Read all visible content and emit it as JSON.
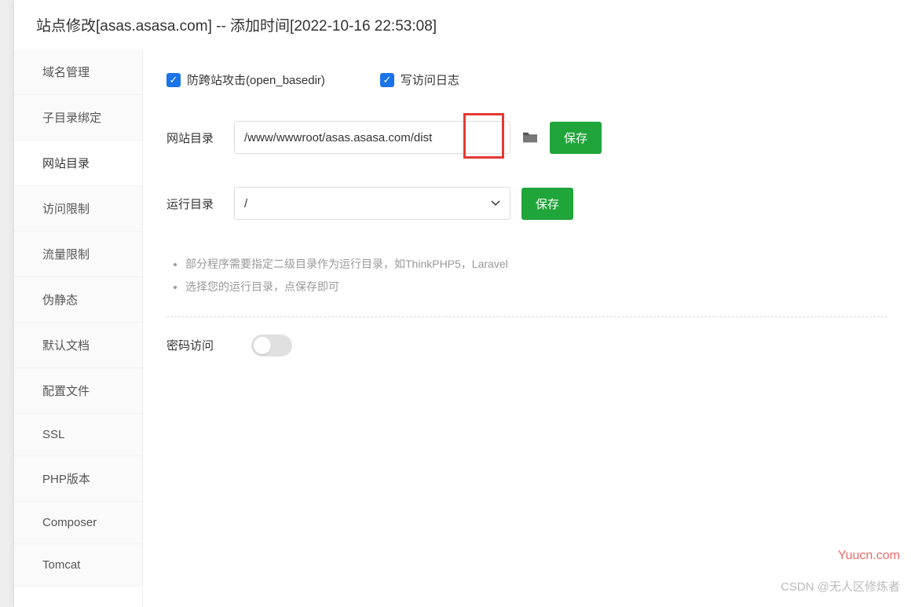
{
  "header": {
    "title": "站点修改[asas.asasa.com] -- 添加时间[2022-10-16 22:53:08]"
  },
  "sidebar": {
    "items": [
      {
        "label": "域名管理"
      },
      {
        "label": "子目录绑定"
      },
      {
        "label": "网站目录"
      },
      {
        "label": "访问限制"
      },
      {
        "label": "流量限制"
      },
      {
        "label": "伪静态"
      },
      {
        "label": "默认文档"
      },
      {
        "label": "配置文件"
      },
      {
        "label": "SSL"
      },
      {
        "label": "PHP版本"
      },
      {
        "label": "Composer"
      },
      {
        "label": "Tomcat"
      }
    ],
    "active_index": 2
  },
  "content": {
    "checkboxes": {
      "open_basedir": {
        "label": "防跨站攻击(open_basedir)",
        "checked": true
      },
      "access_log": {
        "label": "写访问日志",
        "checked": true
      }
    },
    "site_dir": {
      "label": "网站目录",
      "value": "/www/wwwroot/asas.asasa.com/dist",
      "save": "保存"
    },
    "run_dir": {
      "label": "运行目录",
      "value": "/",
      "save": "保存"
    },
    "hints": [
      "部分程序需要指定二级目录作为运行目录，如ThinkPHP5，Laravel",
      "选择您的运行目录，点保存即可"
    ],
    "password_access": {
      "label": "密码访问",
      "enabled": false
    }
  },
  "watermarks": {
    "site": "Yuucn.com",
    "author": "CSDN @无人区修炼者"
  }
}
